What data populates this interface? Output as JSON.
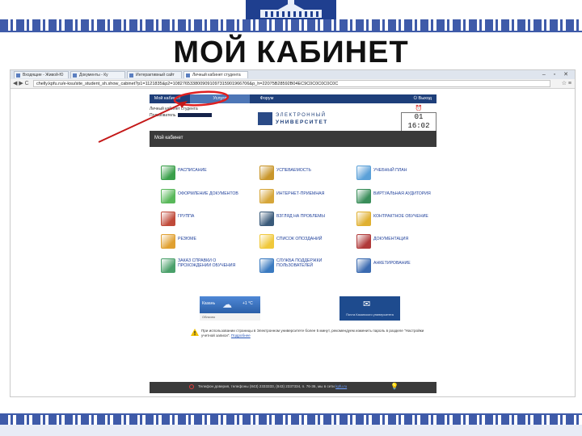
{
  "slide": {
    "title": "МОЙ КАБИНЕТ"
  },
  "browser": {
    "tabs": [
      "Входящие - Живой-Ю",
      "Документы - Ку",
      "Интерактивный сайт",
      "Личный кабинет студента"
    ],
    "window_buttons": "– ▫ ✕",
    "url": "chelly.kpfu.ru/e-ksu/site_student_sh.show_cabinet?p1=1121835&p2=1082765338009091097315901966706&p_h=22075B28592B04EC9C0C0C0C0C0C",
    "nav": "◀ ▶ C",
    "addr_icons": "☆ ≡"
  },
  "site": {
    "nav": {
      "home": "Мой кабинет",
      "services": "Услуги",
      "forum": "Форум",
      "exit": "Выход"
    },
    "user": {
      "line1": "Личный кабинет студента",
      "line2": "Пользователь"
    },
    "logo": {
      "line1": "ЭЛЕКТРОННЫЙ",
      "line2": "УНИВЕРСИТЕТ"
    },
    "clock": {
      "time": "01 16:02"
    },
    "section_title": "Мой кабинет",
    "items": [
      {
        "label": "Расписание",
        "icon": "calendar-icon",
        "color": "#3aa04a"
      },
      {
        "label": "Успеваемость",
        "icon": "chart-bars-icon",
        "color": "#c9962a"
      },
      {
        "label": "Учебный план",
        "icon": "notepad-icon",
        "color": "#5aa0d8"
      },
      {
        "label": "Оформление документов",
        "icon": "document-check-icon",
        "color": "#59b85a"
      },
      {
        "label": "Интернет-приемная",
        "icon": "document-pen-icon",
        "color": "#d6a63a"
      },
      {
        "label": "Виртуальная аудитория",
        "icon": "monitor-icon",
        "color": "#3a8e5a"
      },
      {
        "label": "Группа",
        "icon": "people-icon",
        "color": "#c04a3a"
      },
      {
        "label": "Взгляд на проблемы",
        "icon": "eye-icon",
        "color": "#3a5a7a"
      },
      {
        "label": "Контрактное обучение",
        "icon": "coins-icon",
        "color": "#e0b030"
      },
      {
        "label": "Резюме",
        "icon": "resume-icon",
        "color": "#e0a030"
      },
      {
        "label": "Список опозданий",
        "icon": "lightbulb-icon",
        "color": "#f0c83a"
      },
      {
        "label": "Документация",
        "icon": "binders-icon",
        "color": "#b03a3a"
      },
      {
        "label": "Заказ справки о прохождении обучения",
        "icon": "document-stamp-icon",
        "color": "#4aa06a"
      },
      {
        "label": "Служба поддержки пользователей",
        "icon": "support-globe-icon",
        "color": "#3a7ac0"
      },
      {
        "label": "Анкетирование",
        "icon": "bar-chart-icon",
        "color": "#3a6ab0"
      }
    ],
    "weather": {
      "city": "Казань",
      "temp": "+1 °C",
      "note": "Облачно"
    },
    "mail": {
      "label": "Почта Казанского университета"
    },
    "notice": {
      "text": "При использовании страницы в Электронном университете более 5 минут, рекомендуем изменить пароль в разделе \"Настройки учетной записи\".",
      "link": "Подробнее"
    },
    "footer": {
      "text": "Телефон доверия, телефоны (843) 2333333, (843) 2337334, п. 76-36, мы в сети",
      "link": "kpfu.ru"
    }
  }
}
